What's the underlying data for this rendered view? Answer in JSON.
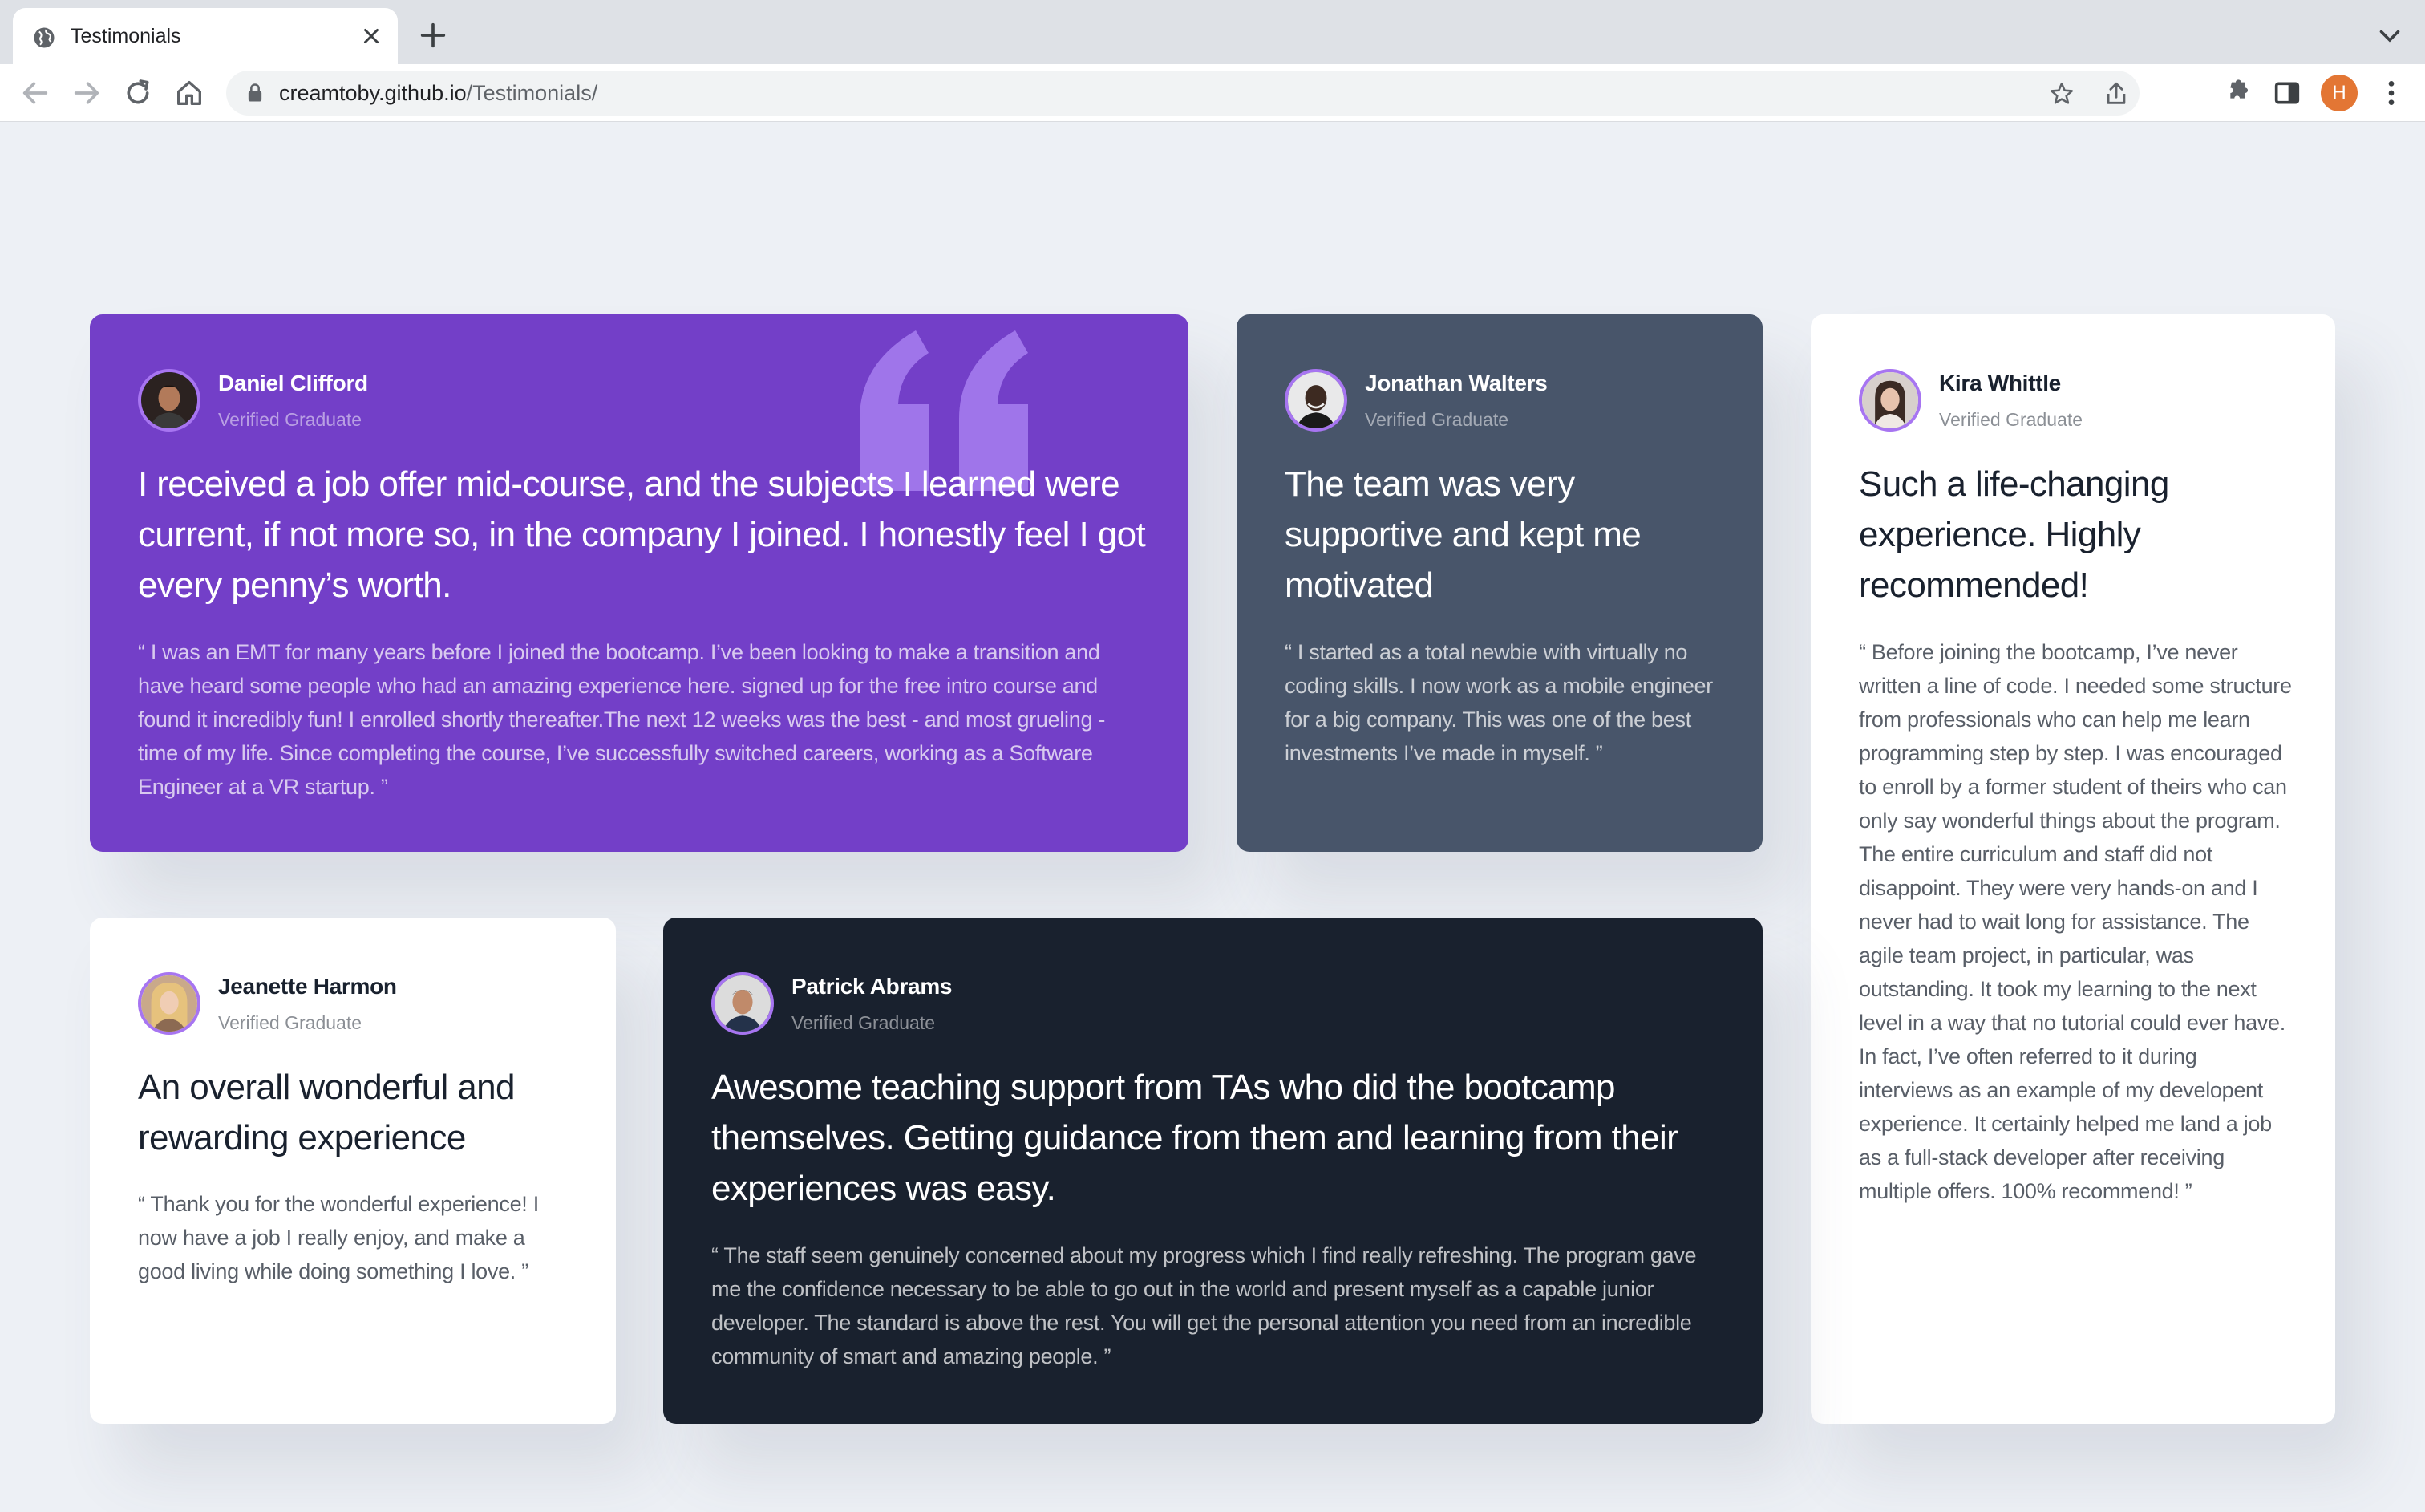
{
  "browser": {
    "tab_title": "Testimonials",
    "url_host": "creamtoby.github.io",
    "url_path": "/Testimonials/",
    "profile_initial": "H"
  },
  "colors": {
    "purple": "#733fc8",
    "slate": "#48556a",
    "dark": "#19212e",
    "white": "#ffffff",
    "page_bg": "#edf0f5",
    "avatar_ring": "#a775f1"
  },
  "testimonials": [
    {
      "name": "Daniel Clifford",
      "role": "Verified Graduate",
      "headline": "I received a job offer mid-course, and the subjects I learned were current, if not more so, in the company I joined. I honestly feel I got every penny’s worth.",
      "body": "“ I was an EMT for many years before I joined the bootcamp. I’ve been looking to make a transition and have heard some people who had an amazing experience here. signed up for the free intro course and found it incredibly fun! I enrolled shortly thereafter.The next 12 weeks was the best - and most grueling - time of my life. Since completing the course, I’ve successfully switched careers, working as a Software Engineer at a VR startup. ”"
    },
    {
      "name": "Jonathan Walters",
      "role": "Verified Graduate",
      "headline": "The team was very supportive and kept me motivated",
      "body": "“ I started as a total newbie with virtually no coding skills. I now work as a mobile engineer for a big company. This was one of the best investments I’ve made in myself. ”"
    },
    {
      "name": "Kira Whittle",
      "role": "Verified Graduate",
      "headline": "Such a life-changing experience. Highly recommended!",
      "body": "“ Before joining the bootcamp, I’ve never written a line of code. I needed some structure from professionals who can help me learn programming step by step. I was encouraged to enroll by a former student of theirs who can only say wonderful things about the program. The entire curriculum and staff did not disappoint. They were very hands-on and I never had to wait long for assistance. The agile team project, in particular, was outstanding. It took my learning to the next level in a way that no tutorial could ever have. In fact, I’ve often referred to it during interviews as an example of my developent experience. It certainly helped me land a job as a full-stack developer after receiving multiple offers. 100% recommend! ”"
    },
    {
      "name": "Jeanette Harmon",
      "role": "Verified Graduate",
      "headline": "An overall wonderful and rewarding experience",
      "body": "“ Thank you for the wonderful experience! I now have a job I really enjoy, and make a good living while doing something I love. ”"
    },
    {
      "name": "Patrick Abrams",
      "role": "Verified Graduate",
      "headline": "Awesome teaching support from TAs who did the bootcamp themselves. Getting guidance from them and learning from their experiences was easy.",
      "body": "“ The staff seem genuinely concerned about my progress which I find really refreshing. The program gave me the confidence necessary to be able to go out in the world and present myself as a capable junior developer. The standard is above the rest. You will get the personal attention you need from an incredible community of smart and amazing people. ”"
    }
  ]
}
